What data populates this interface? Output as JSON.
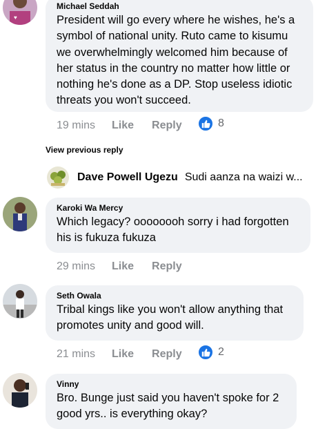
{
  "comments": [
    {
      "author": "Michael Seddah",
      "text": "President will go every where he wishes, he's a symbol of national unity. Ruto came to kisumu we overwhelmingly welcomed him because of her status in the country no matter how little or nothing he's done as a DP. Stop useless idiotic threats you won't succeed.",
      "time": "19 mins",
      "like_label": "Like",
      "reply_label": "Reply",
      "reaction_count": "8"
    },
    {
      "author": "Karoki Wa Mercy",
      "text": "Which legacy? oooooooh sorry i had forgotten his is fukuza fukuza",
      "time": "29 mins",
      "like_label": "Like",
      "reply_label": "Reply"
    },
    {
      "author": "Seth Owala",
      "text": "Tribal kings like you won't allow anything that promotes unity and good will.",
      "time": "21 mins",
      "like_label": "Like",
      "reply_label": "Reply",
      "reaction_count": "2"
    },
    {
      "author": "Vinny",
      "text": "Bro. Bunge just said you haven't spoke for 2 good yrs.. is everything okay?"
    }
  ],
  "view_previous_reply": "View previous reply",
  "reply_preview": {
    "author": "Dave Powell Ugezu",
    "text": "Sudi aanza na waizi w..."
  },
  "colors": {
    "bubble": "#f0f2f5",
    "like_blue": "#1b74e4",
    "meta_gray": "#8a8d91"
  }
}
